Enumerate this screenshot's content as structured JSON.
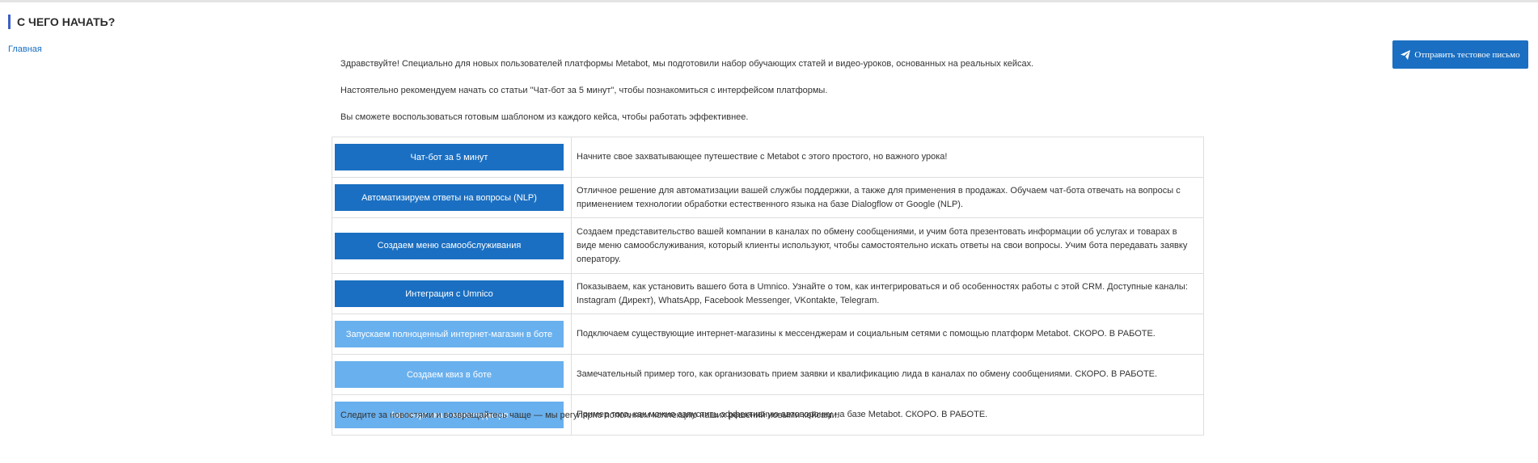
{
  "header": {
    "title": "С ЧЕГО НАЧАТЬ?"
  },
  "breadcrumb": {
    "home": "Главная"
  },
  "actions": {
    "send_test_email": "Отправить тестовое письмо",
    "send_icon": "paper-plane-icon"
  },
  "intro": [
    "Здравствуйте! Специально для новых пользователей платформы Metabot, мы подготовили набор обучающих статей и видео-уроков, основанных на реальных кейсах.",
    "Настоятельно рекомендуем начать со статьи \"Чат-бот за 5 минут\", чтобы познакомиться с интерфейсом платформы.",
    "Вы сможете воспользоваться готовым шаблоном из каждого кейса, чтобы работать эффективнее."
  ],
  "cases": [
    {
      "title": "Чат-бот за 5 минут",
      "status": "available",
      "description": "Начните свое захватывающее путешествие с Metabot с этого простого, но важного урока!"
    },
    {
      "title": "Автоматизируем ответы на вопросы (NLP)",
      "status": "available",
      "description": "Отличное решение для автоматизации вашей службы поддержки, а также для применения в продажах. Обучаем чат-бота отвечать на вопросы с применением технологии обработки естественного языка на базе Dialogflow от Google (NLP)."
    },
    {
      "title": "Создаем меню самообслуживания",
      "status": "available",
      "description": "Создаем представительство вашей компании в каналах по обмену сообщениями, и учим бота презентовать информации об услугах и товарах в виде меню самообслуживания, который клиенты используют, чтобы самостоятельно искать ответы на свои вопросы. Учим бота передавать заявку оператору."
    },
    {
      "title": "Интеграция с Umnico",
      "status": "available",
      "description": "Показываем, как установить вашего бота в Umnico. Узнайте о том, как интегрироваться и об особенностях работы с этой CRM. Доступные каналы: Instagram (Директ), WhatsApp, Facebook Messenger, VKontakte, Telegram."
    },
    {
      "title": "Запускаем полноценный интернет-магазин в боте",
      "status": "soon",
      "description": "Подключаем существующие интернет-магазины к мессенджерам и социальным сетями с помощью платформ Metabot. СКОРО. В РАБОТЕ."
    },
    {
      "title": "Создаем квиз в боте",
      "status": "soon",
      "description": "Замечательный пример того, как организовать прием заявки и квалификацию лида в каналах по обмену сообщениями. СКОРО. В РАБОТЕ."
    },
    {
      "title": "Автоворонка в мессенджере",
      "status": "soon",
      "description": "Пример того, как можно запустить эффективную автоворонку на базе Metabot. СКОРО. В РАБОТЕ."
    }
  ],
  "footer": {
    "text": "Следите за новостями и возвращайтесь чаще — мы регулярно пополняем коллекцию наших решений новыми кейсами."
  },
  "colors": {
    "accent": "#1a6fc2",
    "soon_button": "#69b0ee",
    "title_bar": "#3f5fc6"
  }
}
